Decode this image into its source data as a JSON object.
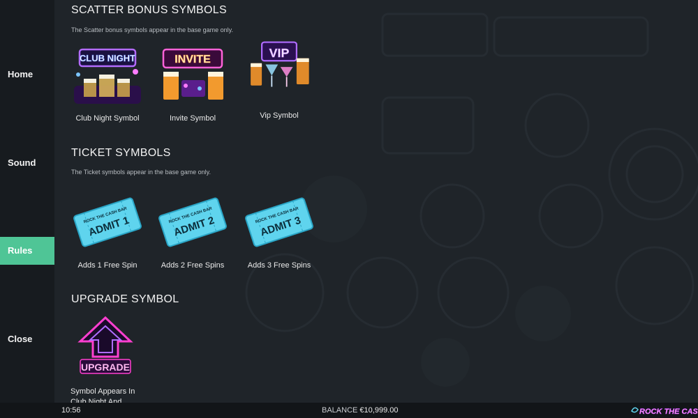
{
  "nav": {
    "home": "Home",
    "sound": "Sound",
    "rules": "Rules",
    "close": "Close"
  },
  "sections": {
    "scatter": {
      "title": "SCATTER BONUS SYMBOLS",
      "desc": "The Scatter bonus symbols appear in the base game only.",
      "symbols": [
        {
          "caption": "Club Night Symbol",
          "art_text": "CLUB NIGHT",
          "icon": "club-night-sign-icon"
        },
        {
          "caption": "Invite Symbol",
          "art_text": "INVITE",
          "icon": "invite-sign-icon"
        },
        {
          "caption": "Vip Symbol",
          "art_text": "VIP",
          "icon": "vip-sign-icon"
        }
      ]
    },
    "ticket": {
      "title": "TICKET SYMBOLS",
      "desc": "The Ticket symbols appear in the base game only.",
      "symbols": [
        {
          "caption": "Adds 1 Free Spin",
          "art_top": "ROCK THE CASH BAR",
          "art_text": "ADMIT 1",
          "icon": "ticket-icon"
        },
        {
          "caption": "Adds 2 Free Spins",
          "art_top": "ROCK THE CASH BAR",
          "art_text": "ADMIT 2",
          "icon": "ticket-icon"
        },
        {
          "caption": "Adds 3 Free Spins",
          "art_top": "ROCK THE CASH BAR",
          "art_text": "ADMIT 3",
          "icon": "ticket-icon"
        }
      ]
    },
    "upgrade": {
      "title": "UPGRADE SYMBOL",
      "symbol": {
        "caption_line1": "Symbol Appears In",
        "caption_line2": "Club Night And",
        "art_text": "UPGRADE",
        "icon": "upgrade-arrow-icon"
      }
    }
  },
  "footer": {
    "time": "10:56",
    "balance_label": "BALANCE",
    "balance_value": "€10,999.00",
    "logo_text": "ROCK THE CASH B"
  },
  "colors": {
    "accent": "#4fc596",
    "ticket": "#5fd4ee",
    "neon_pink": "#ff3fd0",
    "neon_purple": "#8a3bd6"
  }
}
